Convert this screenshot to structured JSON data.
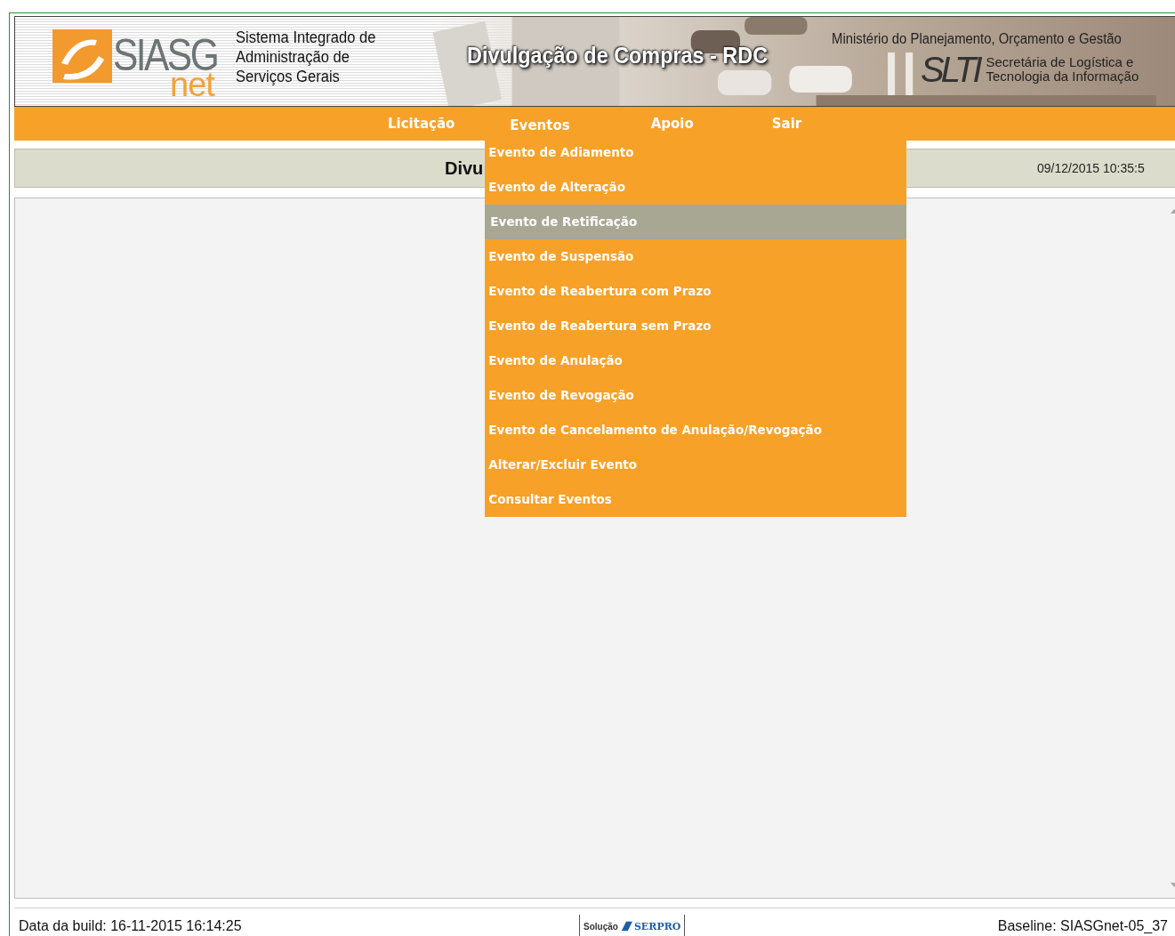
{
  "header": {
    "logo": {
      "mark": "SIASG",
      "sub": "net"
    },
    "system_name": "Sistema Integrado de\nAdministração de\nServiços Gerais",
    "title": "Divulgação de Compras - RDC",
    "ministry": "Ministério do Planejamento, Orçamento e Gestão",
    "department_logo": "SLTI",
    "department": "Secretária de Logística e\nTecnologia da Informação"
  },
  "menu_bar": [
    {
      "label": "Licitação"
    },
    {
      "label": "Eventos",
      "open": true,
      "items": [
        {
          "label": "Evento de Adiamento",
          "selected": false
        },
        {
          "label": "Evento de Alteração",
          "selected": false
        },
        {
          "label": "Evento de Retificação",
          "selected": true
        },
        {
          "label": "Evento de Suspensão",
          "selected": false
        },
        {
          "label": "Evento de Reabertura com Prazo",
          "selected": false
        },
        {
          "label": "Evento de Reabertura sem Prazo",
          "selected": false
        },
        {
          "label": "Evento de Anulação",
          "selected": false
        },
        {
          "label": "Evento de Revogação",
          "selected": false
        },
        {
          "label": "Evento de Cancelamento de Anulação/Revogação",
          "selected": false
        },
        {
          "label": "Alterar/Excluir Evento",
          "selected": false
        },
        {
          "label": "Consultar Eventos",
          "selected": false
        }
      ]
    },
    {
      "label": "Apoio"
    },
    {
      "label": "Sair"
    }
  ],
  "page_title": "Divu",
  "timestamp": "09/12/2015 10:35:5",
  "footer": {
    "build": "Data da build: 16-11-2015 16:14:25",
    "vendor_logo": {
      "prefix": "Solução",
      "name": "SERPRO"
    },
    "baseline": "Baseline: SIASGnet-05_37"
  }
}
